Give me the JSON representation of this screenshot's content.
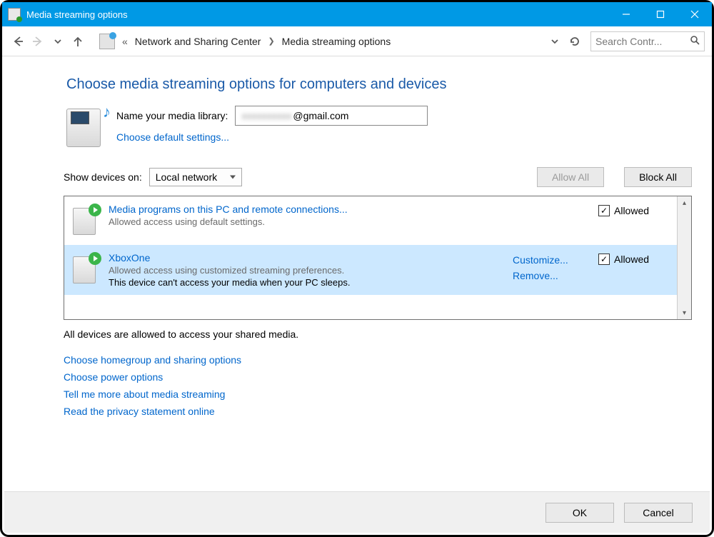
{
  "window": {
    "title": "Media streaming options"
  },
  "breadcrumb": {
    "begin": "«",
    "items": [
      "Network and Sharing Center",
      "Media streaming options"
    ]
  },
  "search": {
    "placeholder": "Search Contr..."
  },
  "heading": "Choose media streaming options for computers and devices",
  "library": {
    "label": "Name your media library:",
    "value_blur": "xxxxxxxxxx",
    "value_suffix": "@gmail.com",
    "defaults_link": "Choose default settings..."
  },
  "show_devices": {
    "label": "Show devices on:",
    "selected": "Local network"
  },
  "buttons": {
    "allow_all": "Allow All",
    "block_all": "Block All",
    "ok": "OK",
    "cancel": "Cancel"
  },
  "devices": [
    {
      "name": "Media programs on this PC and remote connections...",
      "sub": "Allowed access using default settings.",
      "allowed_label": "Allowed",
      "selected": false
    },
    {
      "name": "XboxOne",
      "sub": "Allowed access using customized streaming preferences.",
      "warn": "This device can't access your media when your PC sleeps.",
      "customize": "Customize...",
      "remove": "Remove...",
      "allowed_label": "Allowed",
      "selected": true
    }
  ],
  "status": "All devices are allowed to access your shared media.",
  "links": [
    "Choose homegroup and sharing options",
    "Choose power options",
    "Tell me more about media streaming",
    "Read the privacy statement online"
  ]
}
